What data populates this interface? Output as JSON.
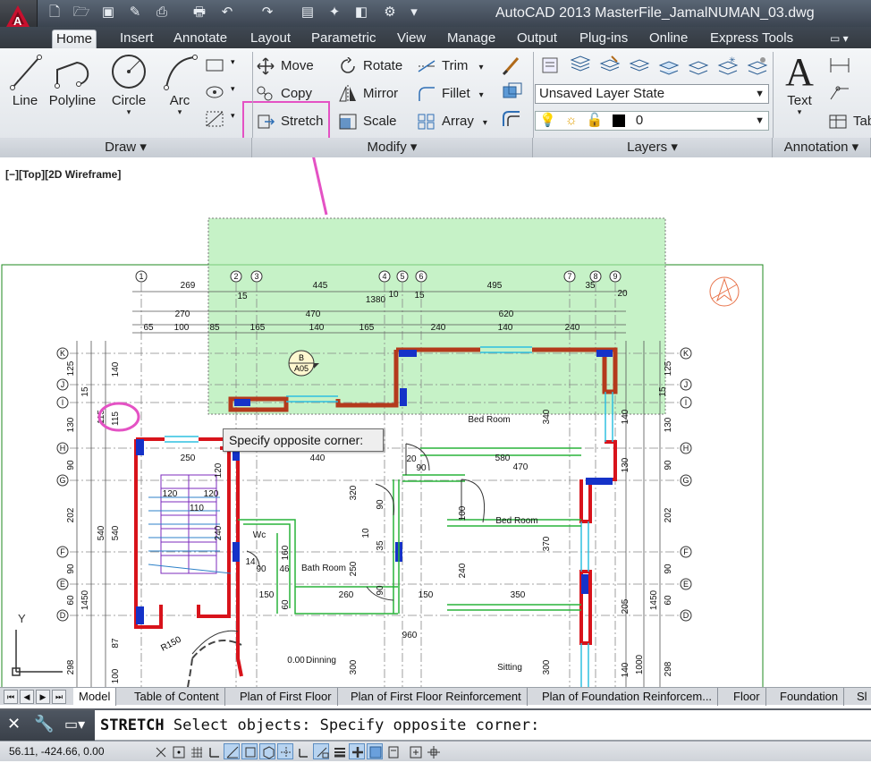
{
  "app": {
    "title": "AutoCAD 2013    MasterFile_JamalNUMAN_03.dwg",
    "colors": {
      "accent_red": "#c8102e",
      "highlight_magenta": "#e452c4",
      "selection_fill": "#a8ecaa",
      "wall_red": "#b43a1c"
    }
  },
  "tabs": [
    "Home",
    "Insert",
    "Annotate",
    "Layout",
    "Parametric",
    "View",
    "Manage",
    "Output",
    "Plug-ins",
    "Online",
    "Express Tools"
  ],
  "ribbon": {
    "draw": {
      "footer": "Draw",
      "buttons": [
        "Line",
        "Polyline",
        "Circle",
        "Arc"
      ]
    },
    "modify": {
      "footer": "Modify",
      "rows": [
        [
          "Move",
          "Rotate",
          "Trim"
        ],
        [
          "Copy",
          "Mirror",
          "Fillet"
        ],
        [
          "Stretch",
          "Scale",
          "Array"
        ]
      ]
    },
    "layers": {
      "footer": "Layers",
      "layer_state": "Unsaved Layer State",
      "current_layer": "0"
    },
    "annotation": {
      "footer": "Annotation",
      "text_label": "Text",
      "table_label": "Tab"
    }
  },
  "viewport": {
    "label": "[−][Top][2D Wireframe]",
    "tooltip": "Specify opposite corner:",
    "axis_y": "Y"
  },
  "plan": {
    "grid_top": [
      "1",
      "2",
      "3",
      "4",
      "5",
      "6",
      "7",
      "8",
      "9"
    ],
    "grid_side": [
      "K",
      "J",
      "I",
      "H",
      "G",
      "F",
      "E",
      "D"
    ],
    "dims_row1": [
      "269",
      "445",
      "495",
      "35",
      "20",
      "15",
      "10",
      "15",
      "1380"
    ],
    "dims_row2": [
      "270",
      "470",
      "620"
    ],
    "dims_row3": [
      "65",
      "100",
      "85",
      "165",
      "140",
      "165",
      "240",
      "140",
      "240"
    ],
    "left_dims": [
      "125",
      "15",
      "130",
      "90",
      "202",
      "90",
      "60",
      "140",
      "115",
      "540",
      "540",
      "1450",
      "87",
      "100",
      "298"
    ],
    "right_dims": [
      "125",
      "15",
      "130",
      "90",
      "202",
      "90",
      "60",
      "130",
      "140",
      "1450",
      "1000",
      "298",
      "140",
      "205"
    ],
    "inner_dims": [
      "250",
      "440",
      "580",
      "470",
      "120",
      "120",
      "110",
      "240",
      "120",
      "20",
      "90",
      "320",
      "90",
      "10",
      "35",
      "90",
      "160",
      "250",
      "14",
      "90",
      "46",
      "150",
      "260",
      "150",
      "350",
      "240",
      "960",
      "60",
      "370",
      "340",
      "300",
      "300",
      "100",
      "0.00"
    ],
    "rooms": [
      "Bed Room",
      "Bed Room",
      "Wc",
      "Bath Room",
      "Dinning",
      "Sitting"
    ],
    "marker": [
      "B",
      "A05"
    ],
    "annot_115": "115",
    "r_label": "R150"
  },
  "layout_tabs": [
    "Model",
    "Table of Content",
    "Plan of First Floor",
    "Plan of First Floor Reinforcement",
    "Plan of Foundation Reinforcem...",
    "Floor",
    "Foundation",
    "Sl"
  ],
  "command": {
    "keyword": "STRETCH",
    "text": "Select objects: Specify opposite corner:"
  },
  "status": {
    "coords": "56.11, -424.66, 0.00"
  }
}
